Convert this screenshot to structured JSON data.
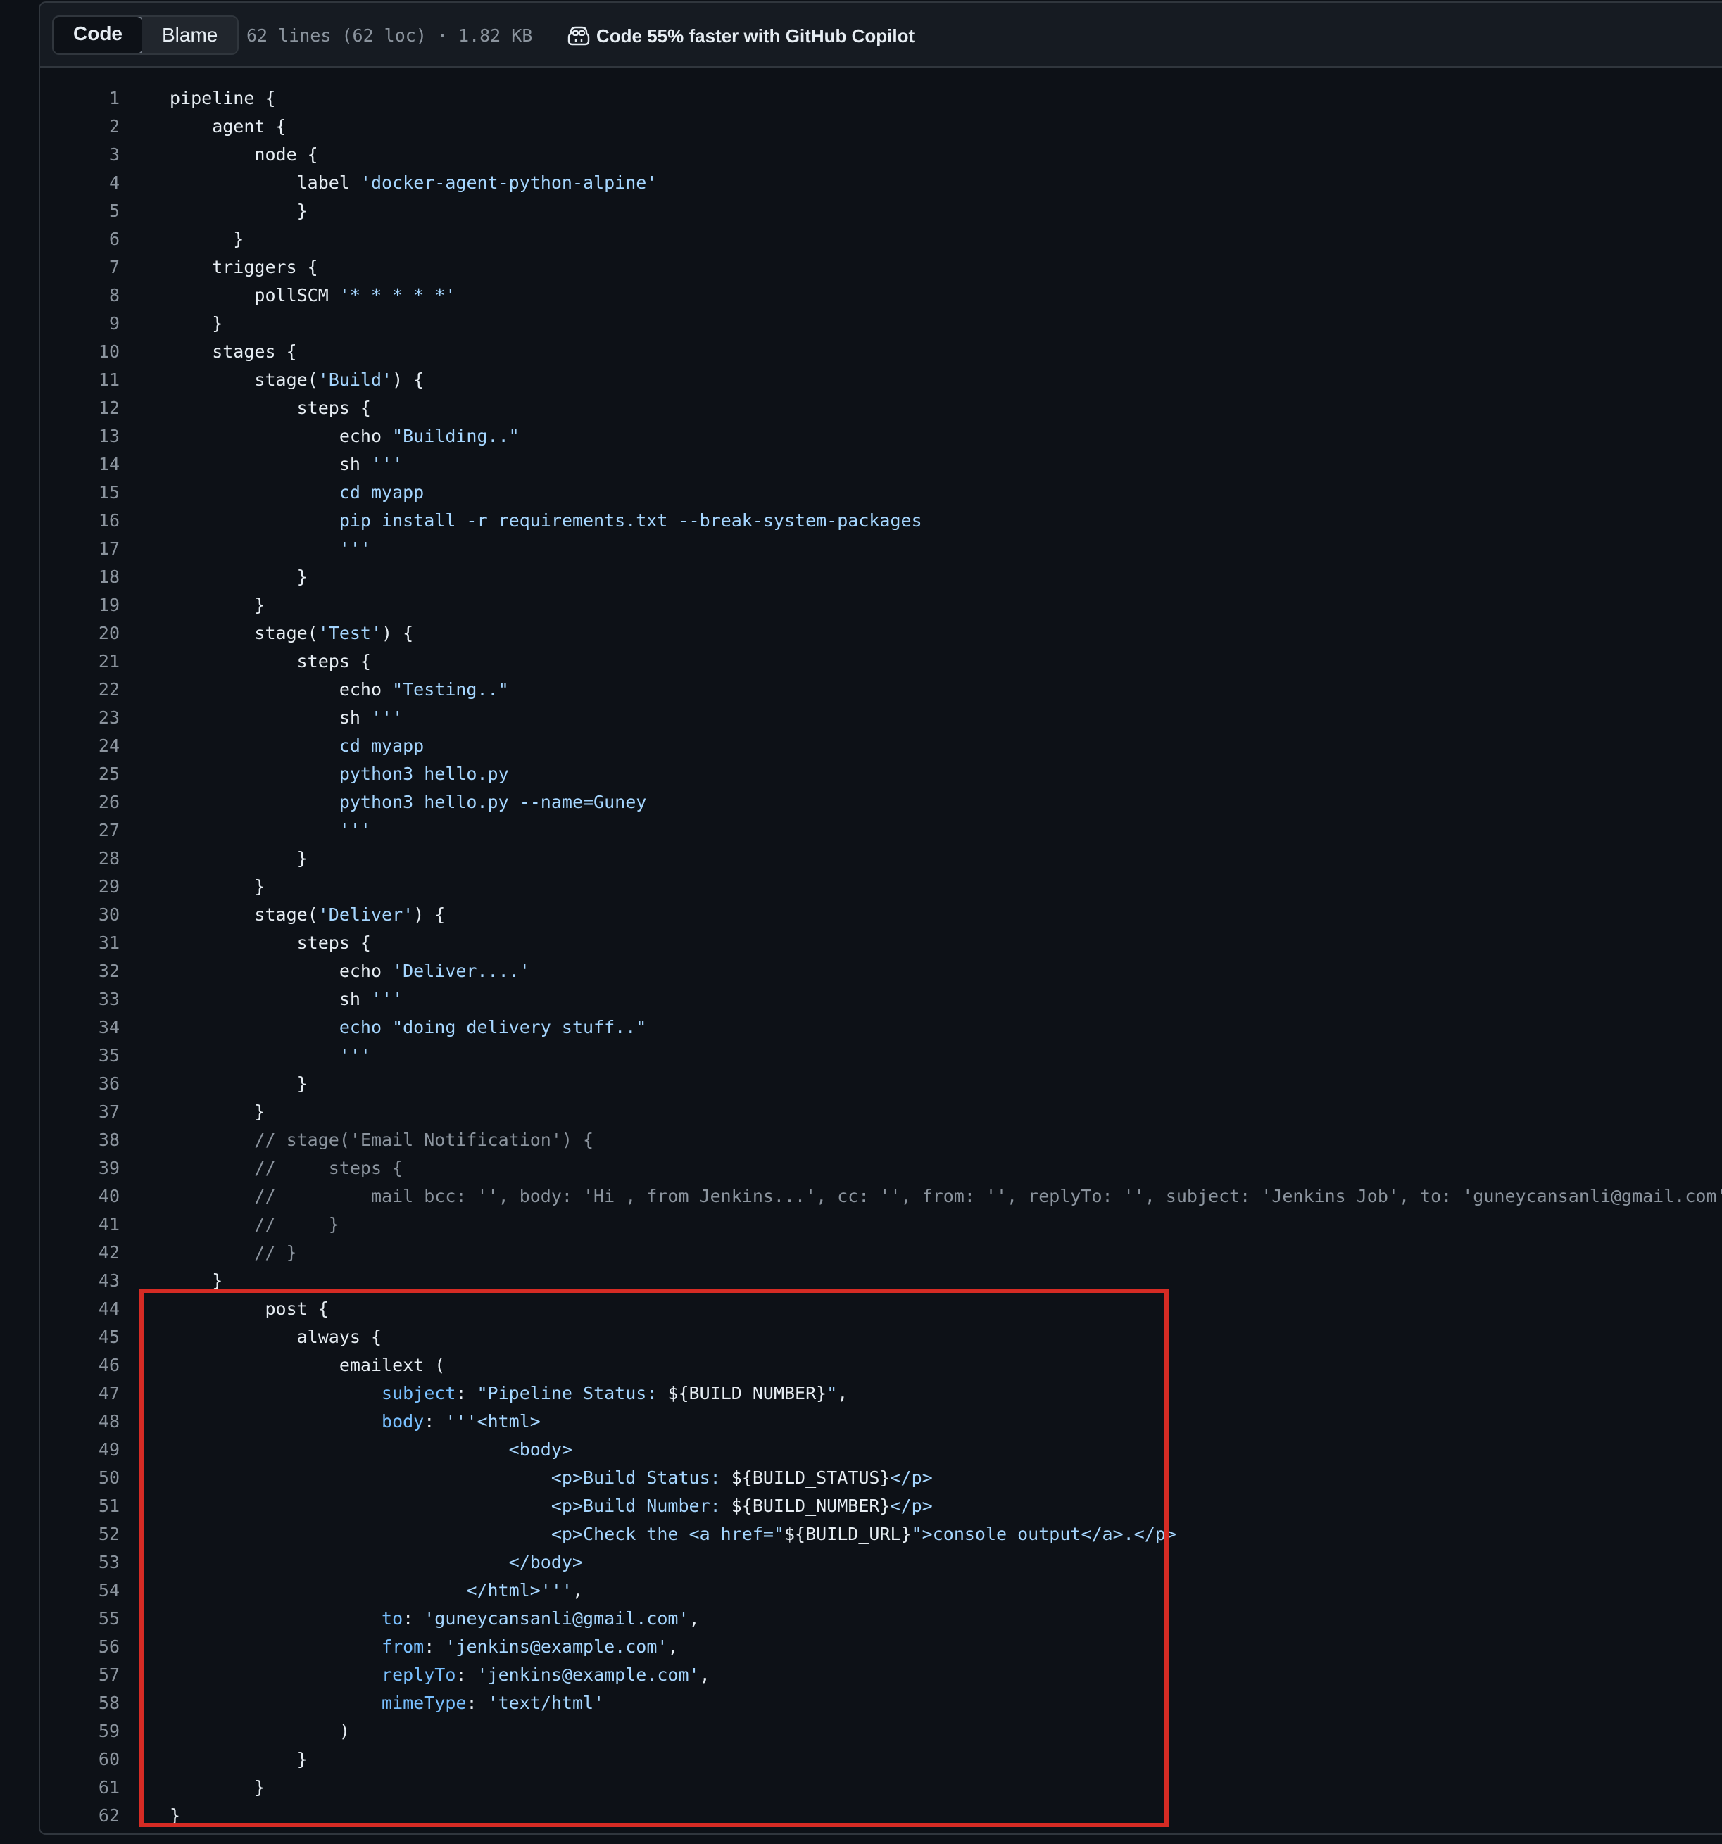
{
  "toolbar": {
    "tabs": [
      {
        "label": "Code",
        "active": true
      },
      {
        "label": "Blame",
        "active": false
      }
    ],
    "meta": "62 lines (62 loc) · 1.82 KB",
    "copilot_promo": "Code 55% faster with GitHub Copilot"
  },
  "colors": {
    "background": "#0d1117",
    "string": "#a5d6ff",
    "keyword": "#79c0ff",
    "comment": "#8b949e",
    "highlight_border": "#d52b24"
  },
  "code": {
    "lines": [
      [
        {
          "t": "pipeline {"
        }
      ],
      [
        {
          "t": "    agent {"
        }
      ],
      [
        {
          "t": "        node {"
        }
      ],
      [
        {
          "t": "            label "
        },
        {
          "t": "'docker-agent-python-alpine'",
          "c": "s"
        }
      ],
      [
        {
          "t": "            }"
        }
      ],
      [
        {
          "t": "      }"
        }
      ],
      [
        {
          "t": "    triggers {"
        }
      ],
      [
        {
          "t": "        pollSCM "
        },
        {
          "t": "'* * * * *'",
          "c": "s"
        }
      ],
      [
        {
          "t": "    }"
        }
      ],
      [
        {
          "t": "    stages {"
        }
      ],
      [
        {
          "t": "        stage("
        },
        {
          "t": "'Build'",
          "c": "s"
        },
        {
          "t": ") {"
        }
      ],
      [
        {
          "t": "            steps {"
        }
      ],
      [
        {
          "t": "                echo "
        },
        {
          "t": "\"Building..\"",
          "c": "s"
        }
      ],
      [
        {
          "t": "                sh "
        },
        {
          "t": "'''",
          "c": "s"
        }
      ],
      [
        {
          "t": "                cd myapp",
          "c": "s"
        }
      ],
      [
        {
          "t": "                pip install -r requirements.txt --break-system-packages",
          "c": "s"
        }
      ],
      [
        {
          "t": "                '''",
          "c": "s"
        }
      ],
      [
        {
          "t": "            }"
        }
      ],
      [
        {
          "t": "        }"
        }
      ],
      [
        {
          "t": "        stage("
        },
        {
          "t": "'Test'",
          "c": "s"
        },
        {
          "t": ") {"
        }
      ],
      [
        {
          "t": "            steps {"
        }
      ],
      [
        {
          "t": "                echo "
        },
        {
          "t": "\"Testing..\"",
          "c": "s"
        }
      ],
      [
        {
          "t": "                sh "
        },
        {
          "t": "'''",
          "c": "s"
        }
      ],
      [
        {
          "t": "                cd myapp",
          "c": "s"
        }
      ],
      [
        {
          "t": "                python3 hello.py",
          "c": "s"
        }
      ],
      [
        {
          "t": "                python3 hello.py --name=Guney",
          "c": "s"
        }
      ],
      [
        {
          "t": "                '''",
          "c": "s"
        }
      ],
      [
        {
          "t": "            }"
        }
      ],
      [
        {
          "t": "        }"
        }
      ],
      [
        {
          "t": "        stage("
        },
        {
          "t": "'Deliver'",
          "c": "s"
        },
        {
          "t": ") {"
        }
      ],
      [
        {
          "t": "            steps {"
        }
      ],
      [
        {
          "t": "                echo "
        },
        {
          "t": "'Deliver....'",
          "c": "s"
        }
      ],
      [
        {
          "t": "                sh "
        },
        {
          "t": "'''",
          "c": "s"
        }
      ],
      [
        {
          "t": "                echo \"doing delivery stuff..\"",
          "c": "s"
        }
      ],
      [
        {
          "t": "                '''",
          "c": "s"
        }
      ],
      [
        {
          "t": "            }"
        }
      ],
      [
        {
          "t": "        }"
        }
      ],
      [
        {
          "t": "        // stage('Email Notification') {",
          "c": "c"
        }
      ],
      [
        {
          "t": "        //     steps {",
          "c": "c"
        }
      ],
      [
        {
          "t": "        //         mail bcc: '', body: 'Hi , from Jenkins...', cc: '', from: '', replyTo: '', subject: 'Jenkins Job', to: 'guneycansanli@gmail.com'",
          "c": "c"
        }
      ],
      [
        {
          "t": "        //     }",
          "c": "c"
        }
      ],
      [
        {
          "t": "        // }",
          "c": "c"
        }
      ],
      [
        {
          "t": "    }"
        }
      ],
      [
        {
          "t": "         post {"
        }
      ],
      [
        {
          "t": "            always {"
        }
      ],
      [
        {
          "t": "                emailext ("
        }
      ],
      [
        {
          "t": "                    "
        },
        {
          "t": "subject",
          "c": "k"
        },
        {
          "t": ": "
        },
        {
          "t": "\"Pipeline Status: ",
          "c": "s"
        },
        {
          "t": "${BUILD_NUMBER}"
        },
        {
          "t": "\"",
          "c": "s"
        },
        {
          "t": ","
        }
      ],
      [
        {
          "t": "                    "
        },
        {
          "t": "body",
          "c": "k"
        },
        {
          "t": ": "
        },
        {
          "t": "'''<html>",
          "c": "s"
        }
      ],
      [
        {
          "t": "                                <body>",
          "c": "s"
        }
      ],
      [
        {
          "t": "                                    <p>Build Status: ",
          "c": "s"
        },
        {
          "t": "${BUILD_STATUS}"
        },
        {
          "t": "</p>",
          "c": "s"
        }
      ],
      [
        {
          "t": "                                    <p>Build Number: ",
          "c": "s"
        },
        {
          "t": "${BUILD_NUMBER}"
        },
        {
          "t": "</p>",
          "c": "s"
        }
      ],
      [
        {
          "t": "                                    <p>Check the <a href=\"",
          "c": "s"
        },
        {
          "t": "${BUILD_URL}"
        },
        {
          "t": "\">console output</a>.</p>",
          "c": "s"
        }
      ],
      [
        {
          "t": "                                </body>",
          "c": "s"
        }
      ],
      [
        {
          "t": "                            </html>'''",
          "c": "s"
        },
        {
          "t": ","
        }
      ],
      [
        {
          "t": "                    "
        },
        {
          "t": "to",
          "c": "k"
        },
        {
          "t": ": "
        },
        {
          "t": "'guneycansanli@gmail.com'",
          "c": "s"
        },
        {
          "t": ","
        }
      ],
      [
        {
          "t": "                    "
        },
        {
          "t": "from",
          "c": "k"
        },
        {
          "t": ": "
        },
        {
          "t": "'jenkins@example.com'",
          "c": "s"
        },
        {
          "t": ","
        }
      ],
      [
        {
          "t": "                    "
        },
        {
          "t": "replyTo",
          "c": "k"
        },
        {
          "t": ": "
        },
        {
          "t": "'jenkins@example.com'",
          "c": "s"
        },
        {
          "t": ","
        }
      ],
      [
        {
          "t": "                    "
        },
        {
          "t": "mimeType",
          "c": "k"
        },
        {
          "t": ": "
        },
        {
          "t": "'text/html'",
          "c": "s"
        }
      ],
      [
        {
          "t": "                )"
        }
      ],
      [
        {
          "t": "            }"
        }
      ],
      [
        {
          "t": "        }"
        }
      ],
      [
        {
          "t": "}"
        }
      ]
    ],
    "highlighted_range": [
      44,
      62
    ]
  }
}
